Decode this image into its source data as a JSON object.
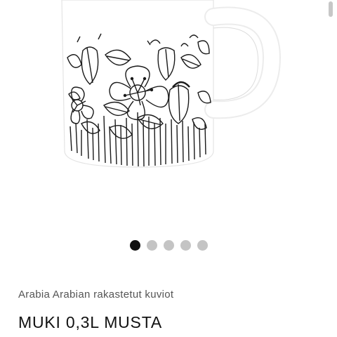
{
  "product": {
    "brand_line": "Arabia Arabian rakastetut kuviot",
    "title": "MUKI 0,3L MUSTA"
  },
  "gallery": {
    "image_count": 5,
    "active_index": 0
  },
  "colors": {
    "active_dot": "#111111",
    "inactive_dot": "#c4c4c4",
    "pattern": "#1a1a1a"
  }
}
